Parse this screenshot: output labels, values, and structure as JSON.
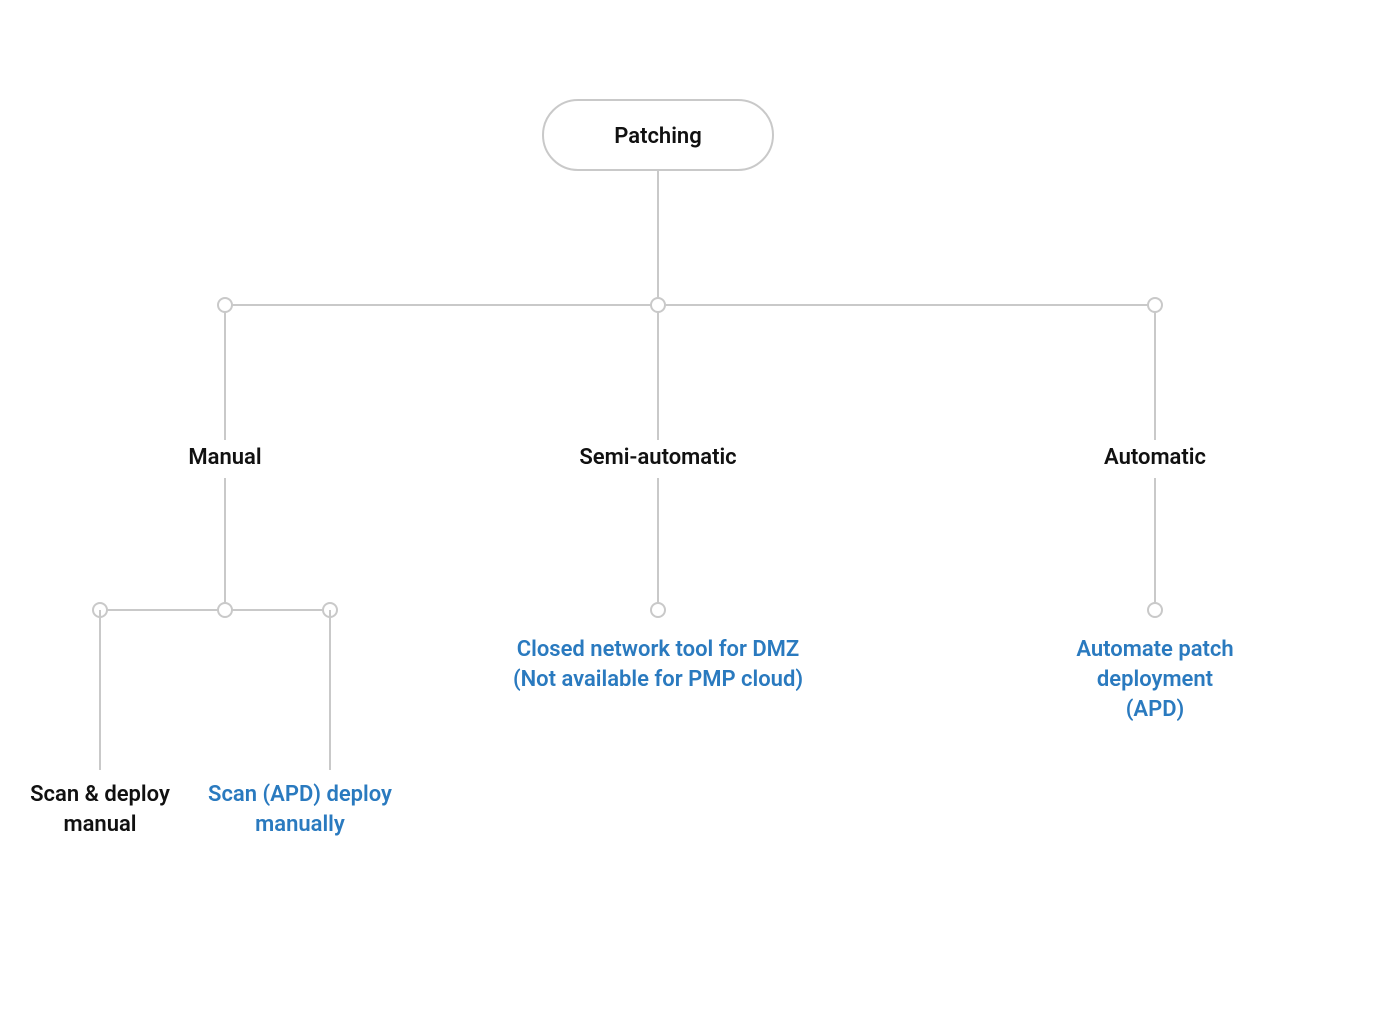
{
  "colors": {
    "line": "#c9c9c9",
    "text": "#111111",
    "link": "#2a7abf",
    "background": "#ffffff"
  },
  "root": {
    "label": "Patching"
  },
  "branches": {
    "manual": {
      "label": "Manual",
      "children": {
        "scan_deploy_manual": {
          "line1": "Scan & deploy",
          "line2": "manual"
        },
        "scan_apd_deploy_manually": {
          "line1": "Scan (APD) deploy",
          "line2": "manually"
        }
      }
    },
    "semi_automatic": {
      "label": "Semi-automatic",
      "child": {
        "line1": "Closed network tool for DMZ",
        "line2": "(Not available for PMP cloud)"
      }
    },
    "automatic": {
      "label": "Automatic",
      "child": {
        "line1": "Automate patch",
        "line2": "deployment",
        "line3": "(APD)"
      }
    }
  }
}
